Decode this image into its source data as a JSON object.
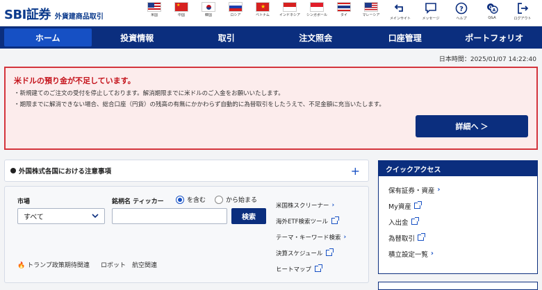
{
  "header": {
    "logo_main": "SBI証券",
    "logo_sub": "外貨建商品取引",
    "flags": [
      {
        "label": "米国",
        "icon": "flag-us-icon"
      },
      {
        "label": "中国",
        "icon": "flag-cn-icon"
      },
      {
        "label": "韓国",
        "icon": "flag-kr-icon"
      },
      {
        "label": "ロシア",
        "icon": "flag-ru-icon"
      },
      {
        "label": "ベトナム",
        "icon": "flag-vn-icon"
      },
      {
        "label": "インドネシア",
        "icon": "flag-id-icon"
      },
      {
        "label": "シンガポール",
        "icon": "flag-sg-icon"
      },
      {
        "label": "タイ",
        "icon": "flag-th-icon"
      },
      {
        "label": "マレーシア",
        "icon": "flag-my-icon"
      }
    ],
    "utilities": [
      {
        "label": "メインサイト",
        "icon": "return-icon"
      },
      {
        "label": "メッセージ",
        "icon": "message-icon"
      },
      {
        "label": "ヘルプ",
        "icon": "help-icon"
      },
      {
        "label": "Q&A",
        "icon": "qa-icon"
      },
      {
        "label": "ログアウト",
        "icon": "logout-icon"
      }
    ]
  },
  "nav": {
    "items": [
      "ホーム",
      "投資情報",
      "取引",
      "注文照会",
      "口座管理",
      "ポートフォリオ"
    ],
    "active": "ホーム"
  },
  "time": {
    "text": "日本時間：2025/01/07 14:22:40"
  },
  "alert": {
    "title": "米ドルの預り金が不足しています。",
    "line1": "・新規建てのご注文の受付を停止しております。解消期限までに米ドルのご入金をお願いいたします。",
    "line2": "・期限までに解消できない場合、総合口座（円貨）の残高の有無にかかわらず自動的に為替取引をしたうえで、不足金額に充当いたします。",
    "button": "詳細へ ＞"
  },
  "notice": {
    "title": "外国株式各国における注意事項",
    "toggle": "+"
  },
  "search": {
    "market_label": "市場",
    "market_value": "すべて",
    "ticker_label": "銘柄名 ティッカー",
    "radio_contains": "を含む",
    "radio_starts": "から始まる",
    "search_button": "検索",
    "tags": [
      "トランプ政策期待関連",
      "ロボット",
      "航空関連"
    ],
    "links": [
      {
        "label": "米国株スクリーナー",
        "type": "arrow"
      },
      {
        "label": "海外ETF検索ツール",
        "type": "external"
      },
      {
        "label": "テーマ・キーワード検索",
        "type": "arrow"
      },
      {
        "label": "決算スケジュール",
        "type": "external"
      },
      {
        "label": "ヒートマップ",
        "type": "external"
      }
    ]
  },
  "quick_access": {
    "title": "クイックアクセス",
    "items": [
      {
        "label": "保有証券・資産",
        "type": "arrow"
      },
      {
        "label": "My資産",
        "type": "external"
      },
      {
        "label": "入出金",
        "type": "external"
      },
      {
        "label": "為替取引",
        "type": "external"
      },
      {
        "label": "積立設定一覧",
        "type": "arrow"
      }
    ]
  },
  "colors": {
    "navy": "#0b2e7e",
    "active_tab": "#1650c4",
    "alert_red": "#d4343c",
    "alert_bg": "#fcecec"
  }
}
